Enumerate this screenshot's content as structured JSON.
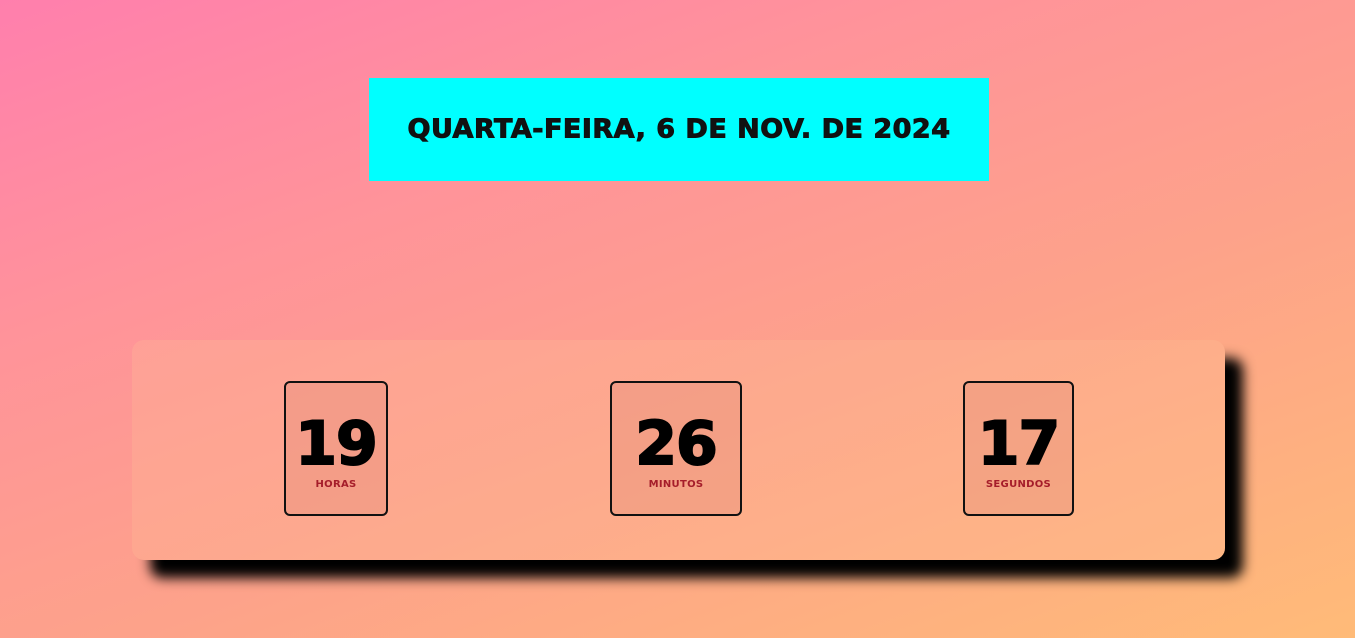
{
  "header": {
    "date": "QUARTA-FEIRA, 6 DE NOV. DE 2024"
  },
  "clock": {
    "hours": {
      "value": "19",
      "label": "HORAS"
    },
    "minutes": {
      "value": "26",
      "label": "MINUTOS"
    },
    "seconds": {
      "value": "17",
      "label": "SEGUNDOS"
    }
  },
  "colors": {
    "banner": "#00ffff",
    "label": "#a51d2a",
    "gradient_start": "#ff7fad",
    "gradient_end": "#ffbb78"
  }
}
